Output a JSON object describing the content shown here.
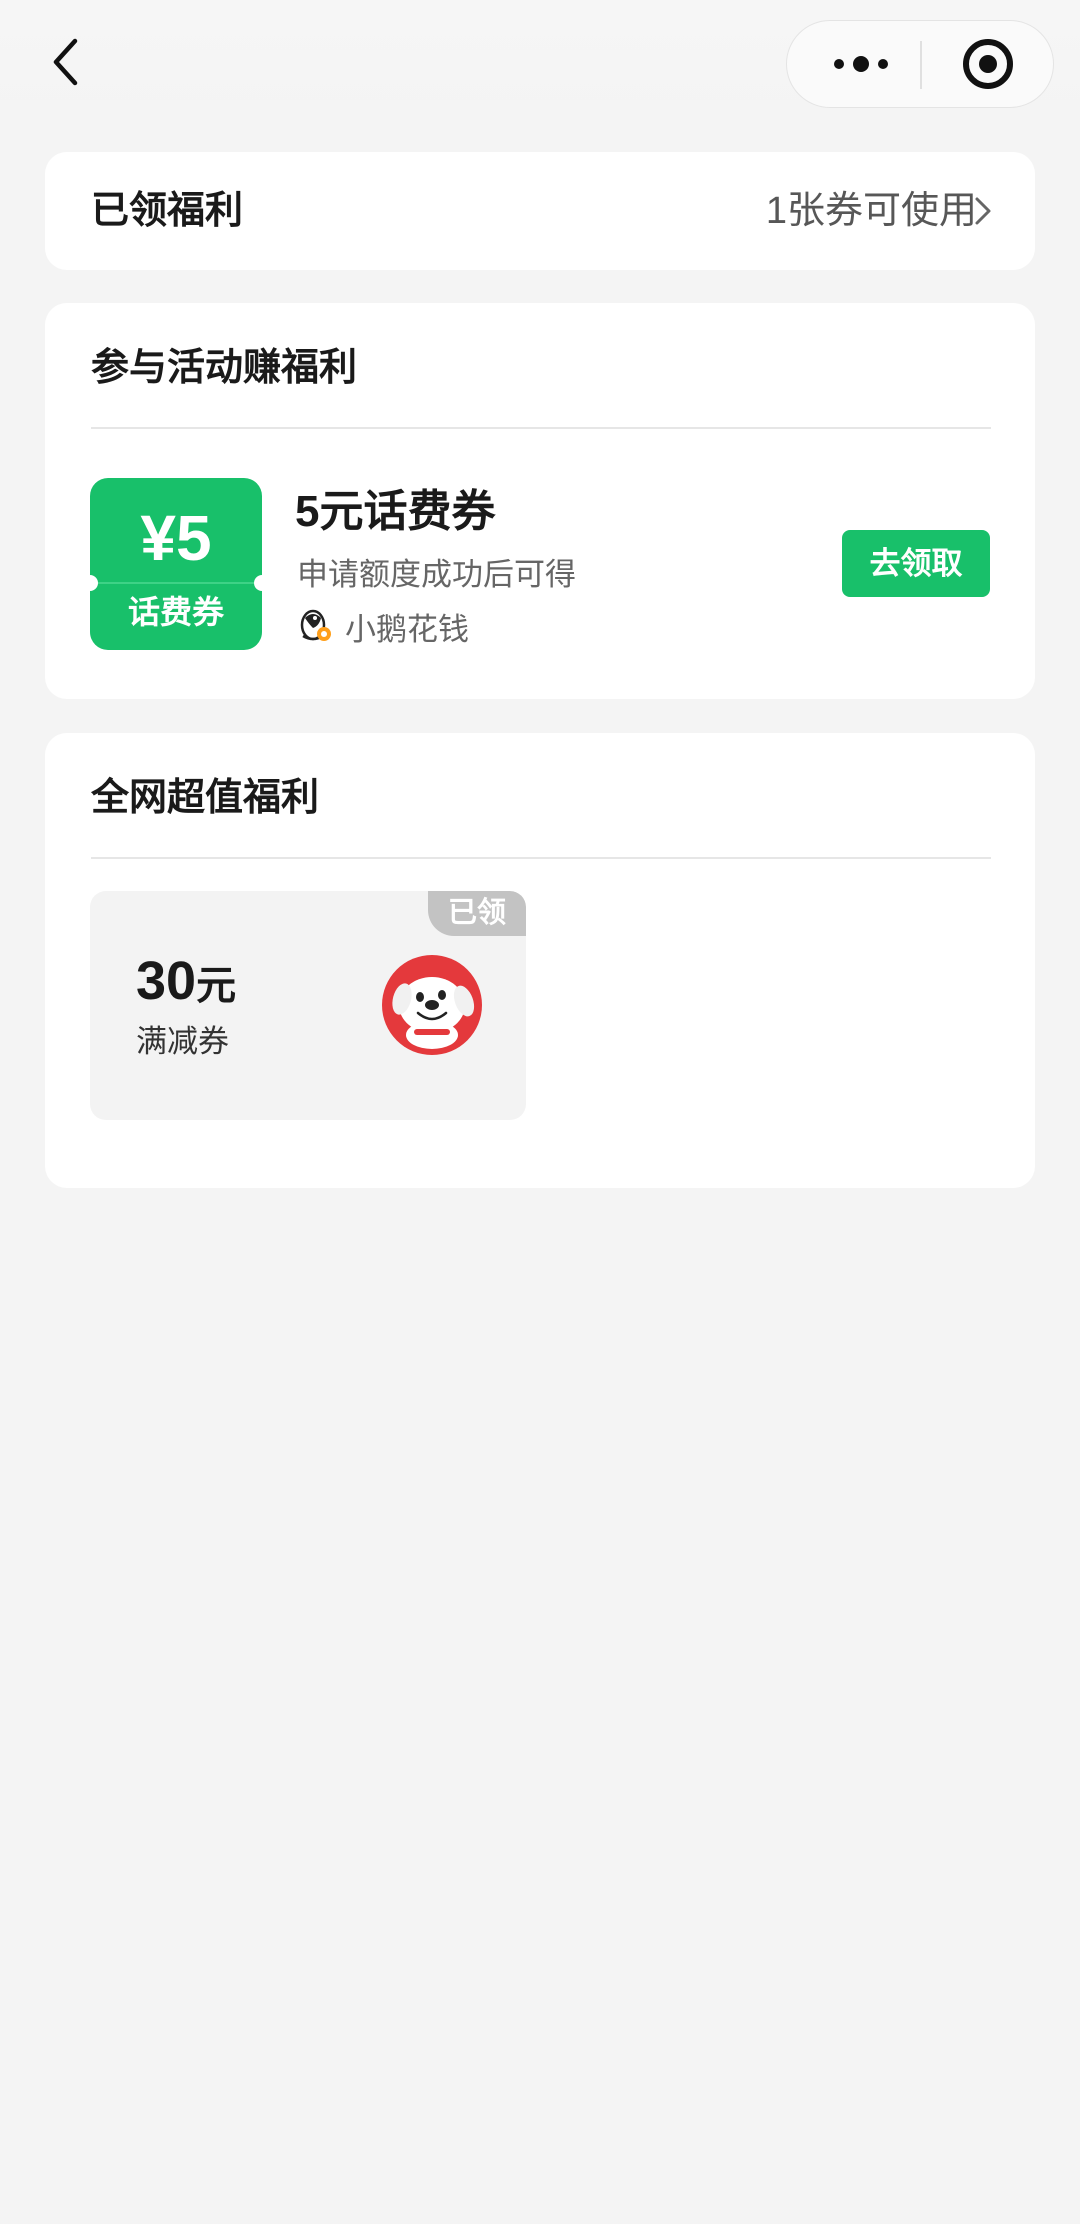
{
  "nav": {
    "back_icon": "chevron-left-icon",
    "more_icon": "more-dots-icon",
    "close_icon": "record-circle-icon"
  },
  "claimed": {
    "title": "已领福利",
    "summary": "1张券可使用",
    "chevron_icon": "chevron-right-icon"
  },
  "activities": {
    "title": "参与活动赚福利",
    "item": {
      "coupon_amount": "¥5",
      "coupon_type": "话费券",
      "title": "5元话费券",
      "subtitle": "申请额度成功后可得",
      "brand_icon": "penguin-logo-icon",
      "brand": "小鹅花钱",
      "action_label": "去领取"
    }
  },
  "deals": {
    "title": "全网超值福利",
    "item": {
      "badge": "已领",
      "value": "30",
      "unit": "元",
      "description": "满减券",
      "logo_icon": "jd-dog-mascot-icon"
    }
  },
  "colors": {
    "accent_green": "#18c06a",
    "background": "#f4f4f4",
    "card": "#ffffff",
    "claimed_badge": "#c3c3c3",
    "jd_red": "#e4393c"
  }
}
